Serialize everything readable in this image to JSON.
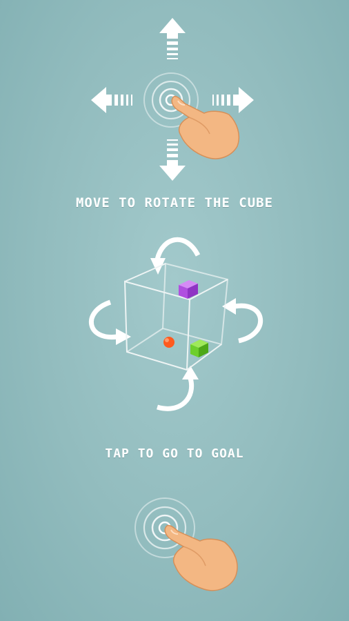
{
  "instructions": {
    "rotate_caption": "MOVE TO ROTATE THE CUBE",
    "tap_caption": "TAP TO GO TO GOAL"
  },
  "colors": {
    "background": "#95bfc1",
    "arrow": "#ffffff",
    "cube_edge": "#eef4f4",
    "purple_block": "#b04fe0",
    "green_block": "#6dcf2c",
    "orange_ball": "#ff5a1e",
    "hand": "#f3b783"
  },
  "icons": [
    "swipe-gesture-icon",
    "direction-arrows-icon",
    "rotate-arrows-icon",
    "wireframe-cube-icon",
    "tap-gesture-icon",
    "hand-pointer-icon"
  ]
}
